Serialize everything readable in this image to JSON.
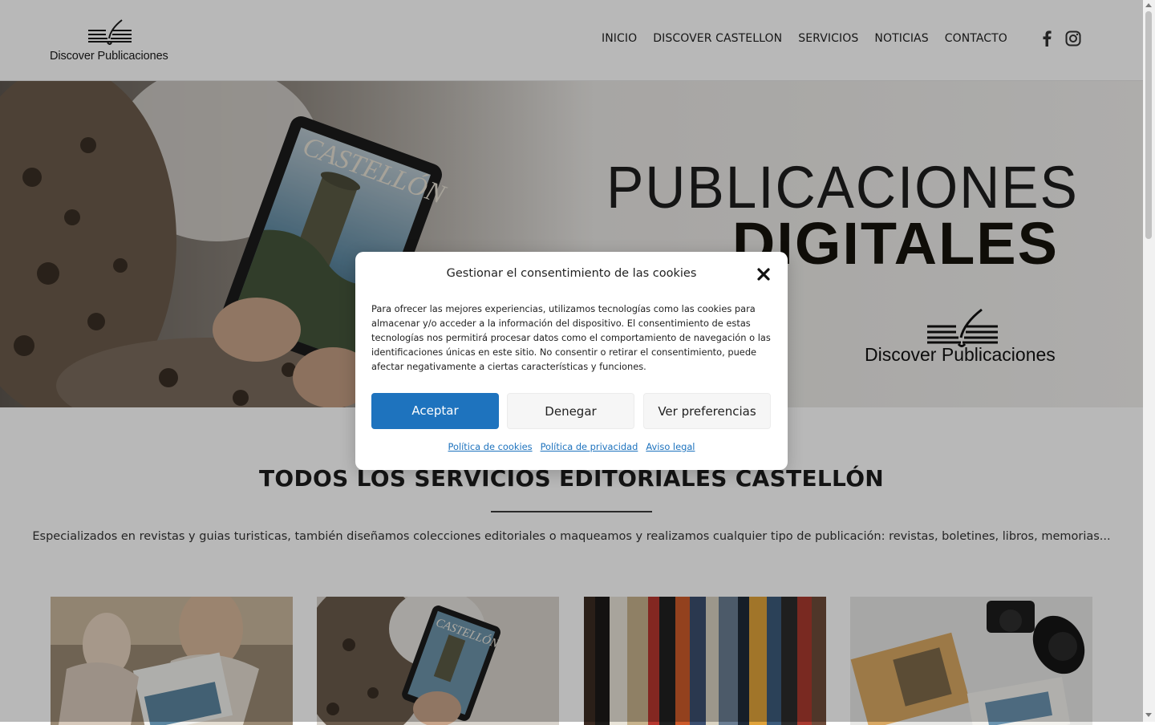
{
  "header": {
    "logo_text": "Discover Publicaciones",
    "nav": [
      "INICIO",
      "DISCOVER CASTELLON",
      "SERVICIOS",
      "NOTICIAS",
      "CONTACTO"
    ],
    "social": [
      "facebook-icon",
      "instagram-icon"
    ]
  },
  "hero": {
    "title_line1": "PUBLICACIONES",
    "title_line2": "DIGITALES",
    "logo_text": "Discover Publicaciones"
  },
  "main": {
    "title": "TODOS LOS SERVICIOS EDITORIALES CASTELLÓN",
    "description": "Especializados en revistas y guias turisticas, también diseñamos colecciones editoriales o maqueamos y realizamos cualquier tipo de publicación: revistas, boletines, libros, memorias..."
  },
  "cookie_modal": {
    "title": "Gestionar el consentimiento de las cookies",
    "body": "Para ofrecer las mejores experiencias, utilizamos tecnologías como las cookies para almacenar y/o acceder a la información del dispositivo. El consentimiento de estas tecnologías nos permitirá procesar datos como el comportamiento de navegación o las identificaciones únicas en este sitio. No consentir o retirar el consentimiento, puede afectar negativamente a ciertas características y funciones.",
    "accept_label": "Aceptar",
    "deny_label": "Denegar",
    "prefs_label": "Ver preferencias",
    "links": [
      "Política de cookies",
      "Política de privacidad",
      "Aviso legal"
    ]
  },
  "colors": {
    "accent": "#1e73be",
    "overlay": "rgba(0,0,0,0.28)"
  }
}
